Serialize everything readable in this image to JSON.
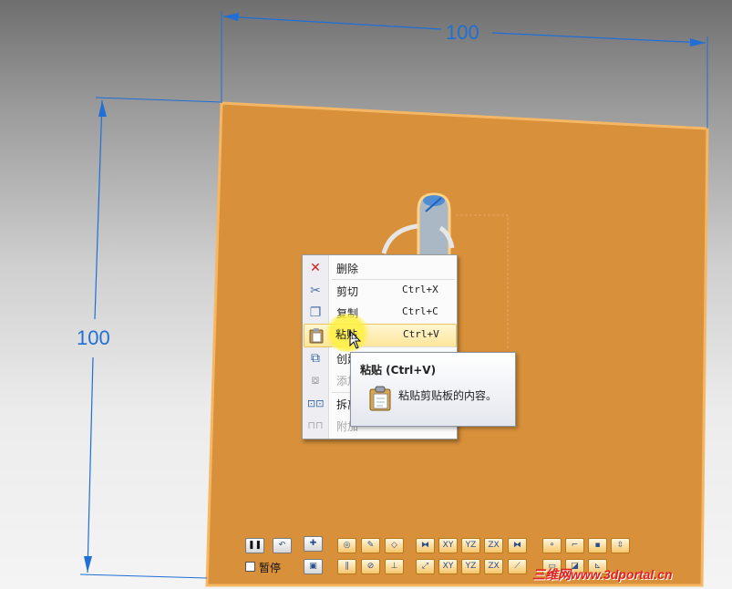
{
  "dimensions": {
    "horizontal": "100",
    "vertical": "100"
  },
  "context_menu": {
    "items": [
      {
        "label": "删除",
        "shortcut": "",
        "icon": "delete-icon",
        "enabled": true
      },
      {
        "label": "剪切",
        "shortcut": "Ctrl+X",
        "icon": "cut-icon",
        "enabled": true
      },
      {
        "label": "复制",
        "shortcut": "Ctrl+C",
        "icon": "copy-icon",
        "enabled": true
      },
      {
        "label": "粘贴",
        "shortcut": "Ctrl+V",
        "icon": "paste-icon",
        "enabled": true,
        "highlighted": true
      },
      {
        "label": "创建",
        "shortcut": "",
        "icon": "create-icon",
        "enabled": true
      },
      {
        "label": "添加",
        "shortcut": "",
        "icon": "add-icon",
        "enabled": false
      },
      {
        "label": "拆离",
        "shortcut": "",
        "icon": "split-icon",
        "enabled": true
      },
      {
        "label": "附加",
        "shortcut": "",
        "icon": "attach-icon",
        "enabled": false
      }
    ]
  },
  "tooltip": {
    "title": "粘贴 (Ctrl+V)",
    "description": "粘贴剪贴板的内容。",
    "icon": "clipboard-icon"
  },
  "toolbar": {
    "pause_label": "暂停",
    "buttons": [
      "XY",
      "YZ",
      "ZX",
      "XY",
      "YZ",
      "ZX"
    ]
  },
  "watermark": "三维网www.3dportal.cn",
  "colors": {
    "sheet": "#d8903a",
    "dimension": "#1f6fd6",
    "highlight": "#fde59a"
  }
}
